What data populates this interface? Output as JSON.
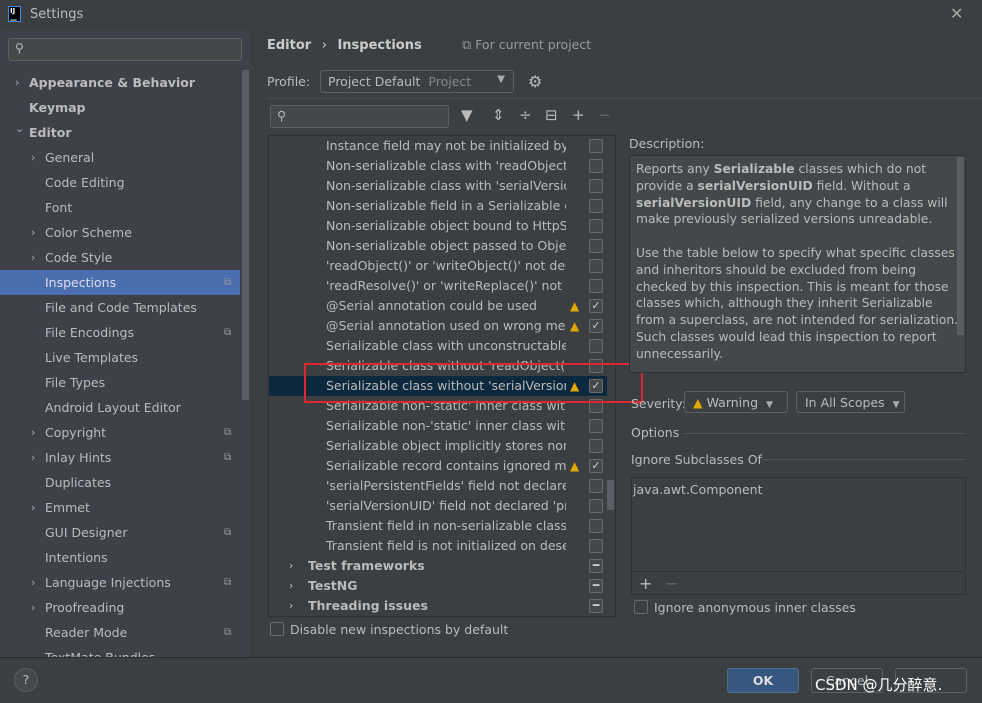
{
  "window": {
    "title": "Settings",
    "app_icon": "IJ",
    "close": "✕"
  },
  "sidebar": {
    "items": [
      {
        "label": "Appearance & Behavior",
        "level": 0,
        "chevron": "right",
        "bold": true
      },
      {
        "label": "Keymap",
        "level": 0,
        "bold": true
      },
      {
        "label": "Editor",
        "level": 0,
        "chevron": "down",
        "bold": true
      },
      {
        "label": "General",
        "level": 1,
        "chevron": "right"
      },
      {
        "label": "Code Editing",
        "level": 1
      },
      {
        "label": "Font",
        "level": 1
      },
      {
        "label": "Color Scheme",
        "level": 1,
        "chevron": "right"
      },
      {
        "label": "Code Style",
        "level": 1,
        "chevron": "right"
      },
      {
        "label": "Inspections",
        "level": 1,
        "selected": true,
        "project": true
      },
      {
        "label": "File and Code Templates",
        "level": 1
      },
      {
        "label": "File Encodings",
        "level": 1,
        "project": true
      },
      {
        "label": "Live Templates",
        "level": 1
      },
      {
        "label": "File Types",
        "level": 1
      },
      {
        "label": "Android Layout Editor",
        "level": 1
      },
      {
        "label": "Copyright",
        "level": 1,
        "chevron": "right",
        "project": true
      },
      {
        "label": "Inlay Hints",
        "level": 1,
        "chevron": "right",
        "project": true
      },
      {
        "label": "Duplicates",
        "level": 1
      },
      {
        "label": "Emmet",
        "level": 1,
        "chevron": "right"
      },
      {
        "label": "GUI Designer",
        "level": 1,
        "project": true
      },
      {
        "label": "Intentions",
        "level": 1
      },
      {
        "label": "Language Injections",
        "level": 1,
        "chevron": "right",
        "project": true
      },
      {
        "label": "Proofreading",
        "level": 1,
        "chevron": "right"
      },
      {
        "label": "Reader Mode",
        "level": 1,
        "project": true
      },
      {
        "label": "TextMate Bundles",
        "level": 1
      }
    ]
  },
  "breadcrumb": {
    "parent": "Editor",
    "current": "Inspections",
    "scope": "For current project"
  },
  "profile": {
    "label": "Profile:",
    "value": "Project Default",
    "kind": "Project"
  },
  "tree": {
    "rows": [
      {
        "label": "Instance field may not be initialized by 'readResolve()'",
        "checked": false
      },
      {
        "label": "Non-serializable class with 'readObject()'",
        "checked": false
      },
      {
        "label": "Non-serializable class with 'serialVersionUID'",
        "checked": false
      },
      {
        "label": "Non-serializable field in a Serializable class",
        "checked": false
      },
      {
        "label": "Non-serializable object bound to HttpSession",
        "checked": false
      },
      {
        "label": "Non-serializable object passed to ObjectOutputStream",
        "checked": false
      },
      {
        "label": "'readObject()' or 'writeObject()' not declared",
        "checked": false
      },
      {
        "label": "'readResolve()' or 'writeReplace()' not declared",
        "checked": false
      },
      {
        "label": "@Serial annotation could be used",
        "checked": true,
        "warning": true
      },
      {
        "label": "@Serial annotation used on wrong member",
        "checked": true,
        "warning": true
      },
      {
        "label": "Serializable class with unconstructable ancestor",
        "checked": false
      },
      {
        "label": "Serializable class without 'readObject()' and 'writeObject()'",
        "checked": false
      },
      {
        "label": "Serializable class without 'serialVersionUID'",
        "checked": true,
        "warning": true,
        "selected": true
      },
      {
        "label": "Serializable non-'static' inner class with non-Serializable outer class",
        "checked": false
      },
      {
        "label": "Serializable non-'static' inner class without 'serialVersionUID'",
        "checked": false
      },
      {
        "label": "Serializable object implicitly stores non-Serializable object",
        "checked": false
      },
      {
        "label": "Serializable record contains ignored members",
        "checked": true,
        "warning": true
      },
      {
        "label": "'serialPersistentFields' field not declared 'private static final'",
        "checked": false
      },
      {
        "label": "'serialVersionUID' field not declared 'private static final long'",
        "checked": false
      },
      {
        "label": "Transient field in non-serializable class",
        "checked": false
      },
      {
        "label": "Transient field is not initialized on deserialization",
        "checked": false
      },
      {
        "label": "Test frameworks",
        "group": true,
        "mixed": true
      },
      {
        "label": "TestNG",
        "group": true,
        "mixed": true
      },
      {
        "label": "Threading issues",
        "group": true,
        "mixed": true
      }
    ],
    "disable_new": "Disable new inspections by default"
  },
  "description": {
    "label": "Description:",
    "p1": [
      "Reports any ",
      "Serializable",
      " classes which do not provide a ",
      "serialVersionUID",
      " field. Without a ",
      "serialVersionUID",
      " field, any change to a class will make previously serialized versions unreadable."
    ],
    "p2": "Use the table below to specify what specific classes and inheritors should be excluded from being checked by this inspection. This is meant for those classes which, although they inherit Serializable from a superclass, are not intended for serialization. Such classes would lead this inspection to report unnecessarily."
  },
  "severity": {
    "label": "Severity:",
    "value": "Warning",
    "scope": "In All Scopes"
  },
  "options": {
    "title": "Options",
    "ignore_title": "Ignore Subclasses Of",
    "list": [
      "java.awt.Component"
    ],
    "add": "+",
    "remove": "−",
    "ignore_anon": "Ignore anonymous inner classes",
    "ignore_anon_checked": false
  },
  "footer": {
    "help": "?",
    "ok": "OK",
    "cancel": "Cancel",
    "apply": "",
    "watermark": "CSDN @几分醉意."
  },
  "colors": {
    "selection": "#4b6eaf",
    "tree_selection": "#0d293e",
    "warning": "#e0a800",
    "highlight_box": "#e0262e"
  }
}
